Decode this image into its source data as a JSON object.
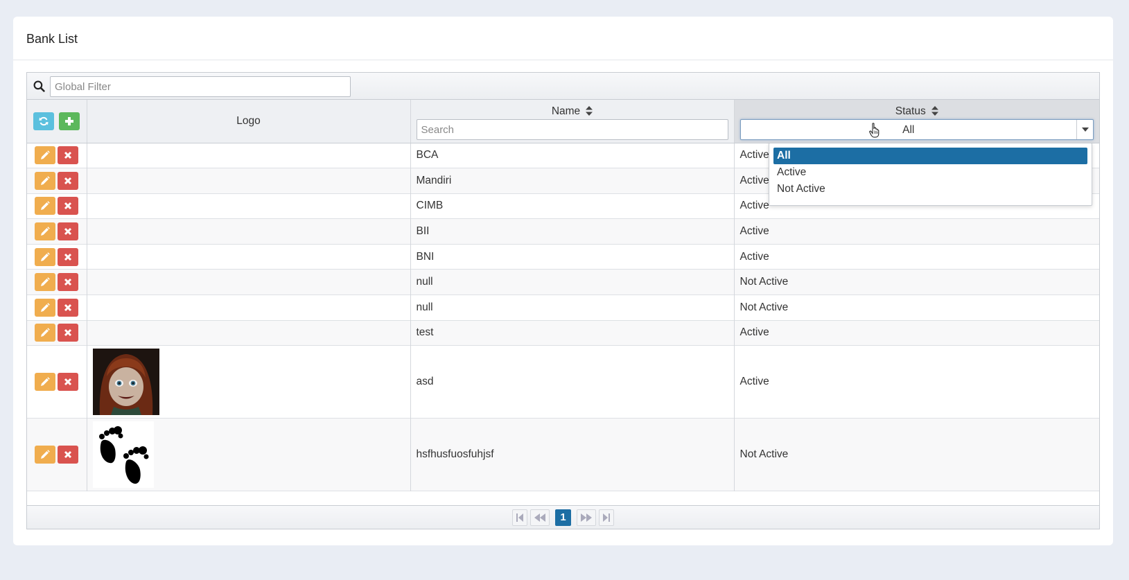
{
  "page": {
    "title": "Bank List"
  },
  "global_filter": {
    "placeholder": "Global Filter",
    "icon": "search-icon"
  },
  "columns": {
    "logo": "Logo",
    "name": "Name",
    "status": "Status"
  },
  "name_filter": {
    "placeholder": "Search"
  },
  "status_filter": {
    "selected": "All",
    "options": [
      "All",
      "Active",
      "Not Active"
    ]
  },
  "rows": [
    {
      "name": "BCA",
      "status": "Active",
      "logo": ""
    },
    {
      "name": "Mandiri",
      "status": "Active",
      "logo": ""
    },
    {
      "name": "CIMB",
      "status": "Active",
      "logo": ""
    },
    {
      "name": "BII",
      "status": "Active",
      "logo": ""
    },
    {
      "name": "BNI",
      "status": "Active",
      "logo": ""
    },
    {
      "name": "null",
      "status": "Not Active",
      "logo": ""
    },
    {
      "name": "null",
      "status": "Not Active",
      "logo": ""
    },
    {
      "name": "test",
      "status": "Active",
      "logo": ""
    },
    {
      "name": "asd",
      "status": "Active",
      "logo": "doll-portrait"
    },
    {
      "name": "hsfhusfuosfuhjsf",
      "status": "Not Active",
      "logo": "footprints"
    }
  ],
  "paginator": {
    "current_page": "1"
  },
  "colors": {
    "refresh": "#5bc0de",
    "add": "#5cb85c",
    "edit": "#f0ad4e",
    "delete": "#d9534f",
    "selected": "#1c6ea4"
  }
}
